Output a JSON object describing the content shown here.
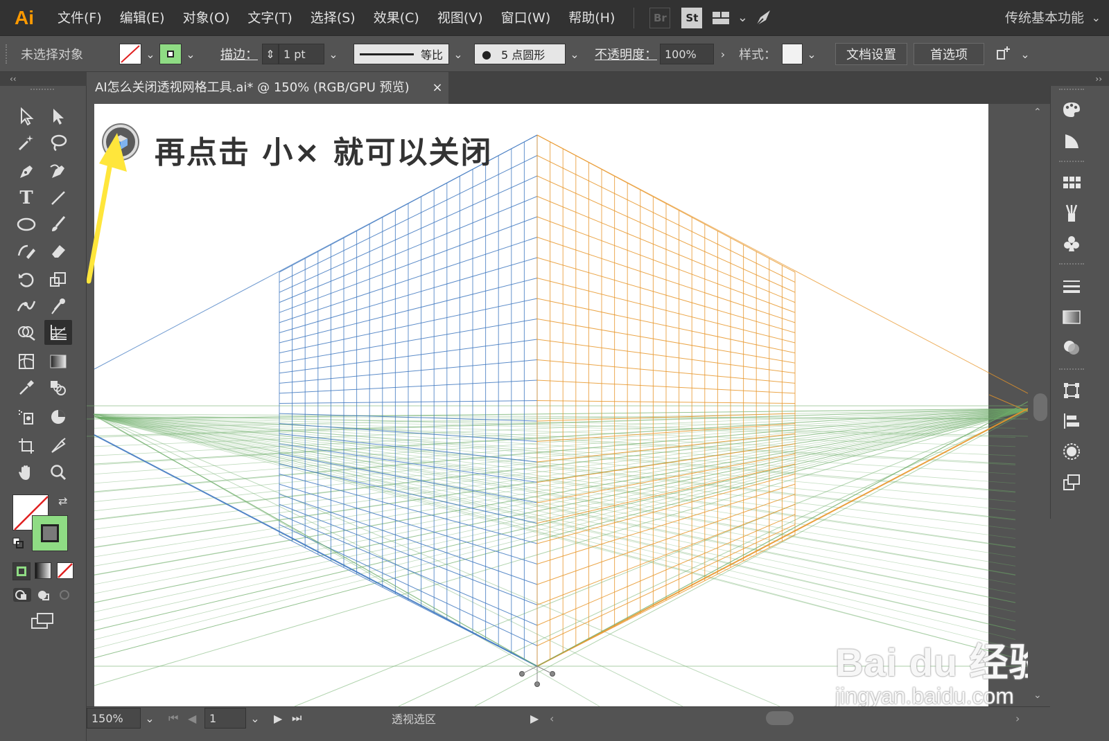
{
  "app": {
    "logo": "Ai",
    "workspace": "传统基本功能"
  },
  "menu": [
    "文件(F)",
    "编辑(E)",
    "对象(O)",
    "文字(T)",
    "选择(S)",
    "效果(C)",
    "视图(V)",
    "窗口(W)",
    "帮助(H)"
  ],
  "menubar_badges": {
    "bridge": "Br",
    "stock": "St"
  },
  "control_bar": {
    "selection": "未选择对象",
    "stroke_label": "描边：",
    "stroke_weight": "1 pt",
    "profile": "等比",
    "brush": "5 点圆形",
    "opacity_label": "不透明度：",
    "opacity": "100%",
    "style_label": "样式：",
    "doc_setup": "文档设置",
    "preferences": "首选项"
  },
  "document": {
    "tab_title": "AI怎么关闭透视网格工具.ai* @ 150% (RGB/GPU 预览)",
    "close": "×"
  },
  "annotation": "再点击 小× 就可以关闭",
  "status_bar": {
    "zoom": "150%",
    "artboard": "1",
    "status": "透视选区"
  },
  "watermark": {
    "logo": "Bai du 经验",
    "url": "jingyan.baidu.com"
  },
  "colors": {
    "left_plane": "#3f78c0",
    "right_plane": "#e8962a",
    "ground_plane": "#6fae6a",
    "arrow": "#ffe63b",
    "fill_swatch": "#8fdc84"
  },
  "icons": {
    "tools": [
      "selection-icon",
      "direct-selection-icon",
      "magic-wand-icon",
      "lasso-icon",
      "pen-icon",
      "curvature-icon",
      "type-icon",
      "line-icon",
      "ellipse-icon",
      "paintbrush-icon",
      "shaper-icon",
      "eraser-icon",
      "rotate-icon",
      "scale-icon",
      "width-icon",
      "puppet-warp-icon",
      "shape-builder-icon",
      "perspective-grid-icon",
      "mesh-icon",
      "gradient-icon",
      "eyedropper-icon",
      "blend-icon",
      "symbol-sprayer-icon",
      "graph-icon",
      "artboard-icon",
      "slice-icon",
      "hand-icon",
      "zoom-icon"
    ],
    "panels": [
      "color-icon",
      "color-guide-icon",
      "swatches-icon",
      "brushes-icon",
      "symbols-icon",
      "stroke-icon",
      "gradient-panel-icon",
      "transparency-icon",
      "transform-icon",
      "align-icon",
      "appearance-icon",
      "layers-icon"
    ]
  }
}
